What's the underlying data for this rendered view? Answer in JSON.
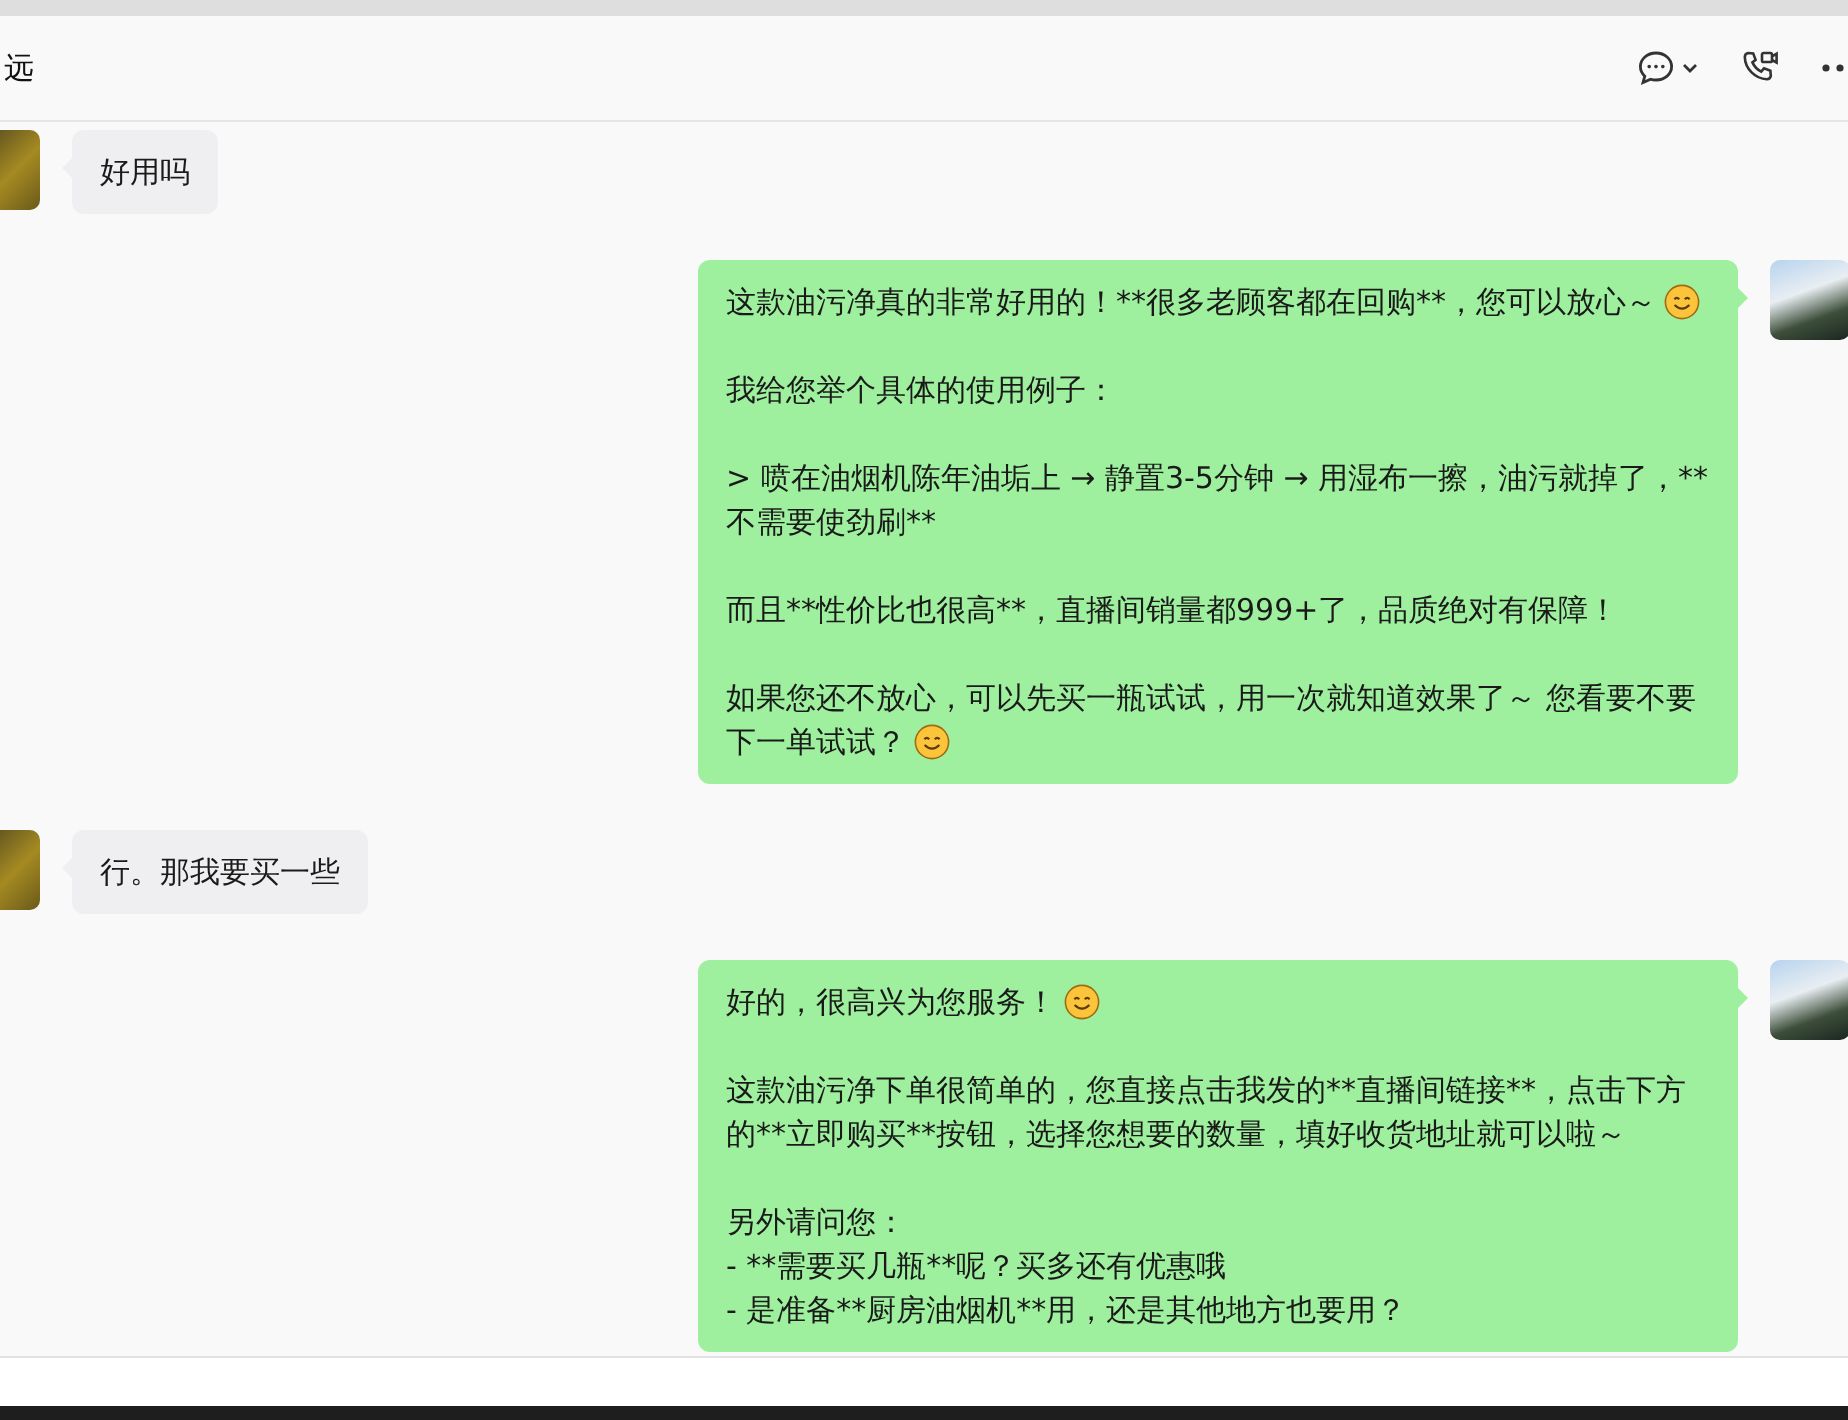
{
  "header": {
    "title": "远"
  },
  "messages": [
    {
      "kind": "incoming",
      "paragraphs": [
        {
          "text": "好用吗",
          "emoji": false
        }
      ]
    },
    {
      "kind": "outgoing",
      "paragraphs": [
        {
          "text": "这款油污净真的非常好用的！**很多老顾客都在回购**，您可以放心～",
          "emoji": true
        },
        {
          "text": "我给您举个具体的使用例子：",
          "emoji": false
        },
        {
          "text": "> 喷在油烟机陈年油垢上 → 静置3-5分钟 → 用湿布一擦，油污就掉了，**不需要使劲刷**",
          "emoji": false
        },
        {
          "text": "而且**性价比也很高**，直播间销量都999+了，品质绝对有保障！",
          "emoji": false
        },
        {
          "text": "如果您还不放心，可以先买一瓶试试，用一次就知道效果了～ 您看要不要下一单试试？",
          "emoji": true
        }
      ]
    },
    {
      "kind": "incoming",
      "paragraphs": [
        {
          "text": "行。那我要买一些",
          "emoji": false
        }
      ]
    },
    {
      "kind": "outgoing",
      "paragraphs": [
        {
          "text": "好的，很高兴为您服务！",
          "emoji": true
        },
        {
          "text": "这款油污净下单很简单的，您直接点击我发的**直播间链接**，点击下方的**立即购买**按钮，选择您想要的数量，填好收货地址就可以啦～",
          "emoji": false
        },
        {
          "text": "另外请问您：\n- **需要买几瓶**呢？买多还有优惠哦\n- 是准备**厨房油烟机**用，还是其他地方也要用？",
          "emoji": false
        }
      ]
    }
  ]
}
